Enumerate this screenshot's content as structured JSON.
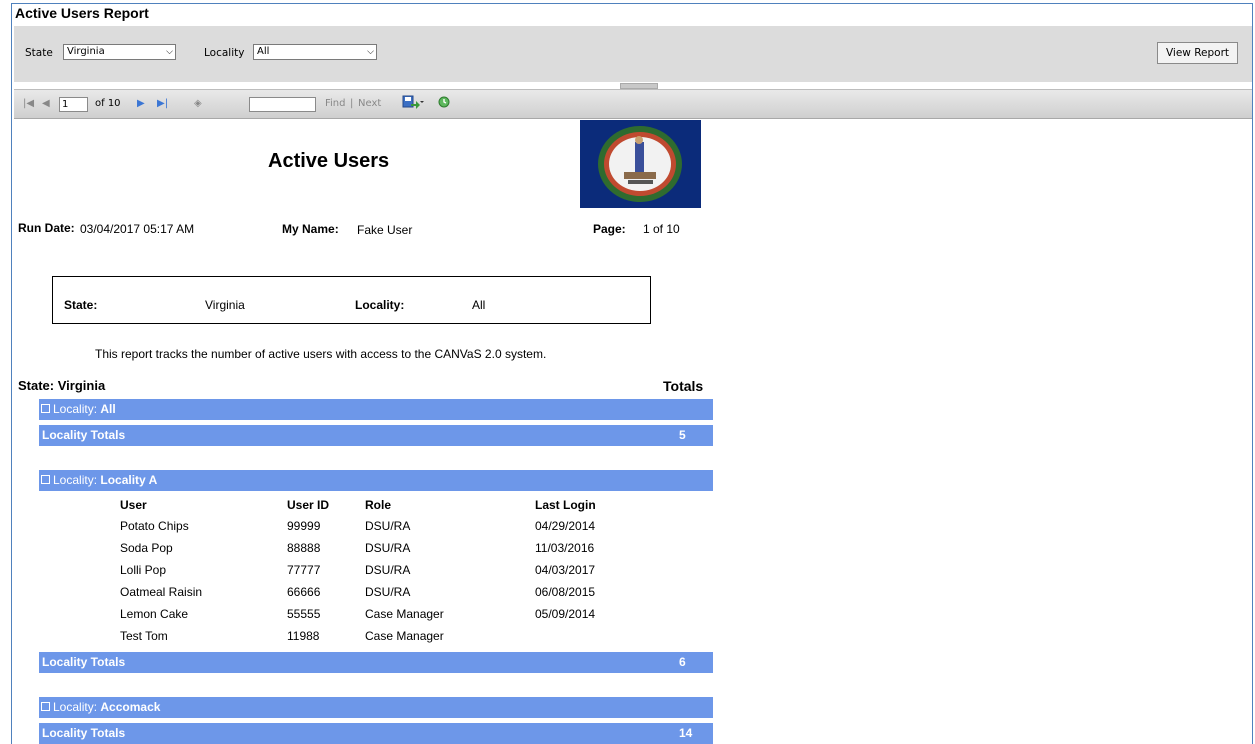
{
  "window": {
    "title": "Active Users Report"
  },
  "parameters": {
    "state_label": "State",
    "state_value": "Virginia",
    "locality_label": "Locality",
    "locality_value": "All",
    "view_report_label": "View Report"
  },
  "toolbar": {
    "page_current": "1",
    "page_total": "of 10",
    "find_value": "",
    "find_label": "Find",
    "separator": "|",
    "next_label": "Next"
  },
  "report": {
    "title": "Active Users",
    "run_date_label": "Run Date:",
    "run_date_value": "03/04/2017  05:17 AM",
    "my_name_label": "My Name:",
    "my_name_value": "Fake User",
    "page_label": "Page:",
    "page_value": "1 of 10",
    "box": {
      "state_label": "State:",
      "state_value": "Virginia",
      "locality_label": "Locality:",
      "locality_value": "All"
    },
    "description": "This report tracks the number of active users with access to the CANVaS 2.0 system.",
    "state_header": "State:  Virginia",
    "totals_header": "Totals",
    "locality_prefix": "Locality:",
    "locality_totals_label": "Locality Totals",
    "columns": [
      "User",
      "User ID",
      "Role",
      "Last Login"
    ],
    "groups": [
      {
        "name": "All",
        "total": "5"
      },
      {
        "name": "Locality A",
        "total": "6",
        "rows": [
          [
            "Potato Chips",
            "99999",
            "DSU/RA",
            "04/29/2014"
          ],
          [
            "Soda Pop",
            "88888",
            "DSU/RA",
            "11/03/2016"
          ],
          [
            "Lolli Pop",
            "77777",
            "DSU/RA",
            "04/03/2017"
          ],
          [
            "Oatmeal Raisin",
            "66666",
            "DSU/RA",
            "06/08/2015"
          ],
          [
            "Lemon Cake",
            "55555",
            "Case Manager",
            "05/09/2014"
          ],
          [
            "Test Tom",
            "11988",
            "Case Manager",
            ""
          ]
        ]
      },
      {
        "name": "Accomack",
        "total": "14"
      }
    ]
  },
  "colors": {
    "band": "#6d97e9",
    "flag": "#0b2b7a",
    "border": "#4f81bd"
  }
}
